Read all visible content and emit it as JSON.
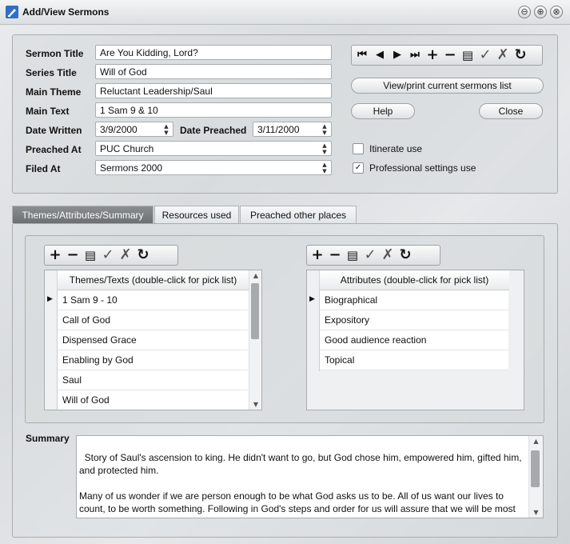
{
  "window": {
    "title": "Add/View Sermons",
    "buttons": [
      "⊖",
      "⊕",
      "⊗"
    ]
  },
  "form": {
    "sermon_title": {
      "label": "Sermon Title",
      "value": "Are You Kidding, Lord?"
    },
    "series_title": {
      "label": "Series Title",
      "value": "Will of God"
    },
    "main_theme": {
      "label": "Main Theme",
      "value": "Reluctant Leadership/Saul"
    },
    "main_text": {
      "label": "Main Text",
      "value": "1 Sam 9 & 10"
    },
    "date_written": {
      "label": "Date Written",
      "value": "3/9/2000"
    },
    "date_preached": {
      "label": "Date Preached",
      "value": "3/11/2000"
    },
    "preached_at": {
      "label": "Preached At",
      "value": "PUC Church"
    },
    "filed_at": {
      "label": "Filed At",
      "value": "Sermons 2000"
    }
  },
  "nav_toolbar": [
    "first-icon",
    "prev-icon",
    "next-icon",
    "last-icon",
    "add-icon",
    "remove-icon",
    "edit-icon",
    "check-icon",
    "cancel-icon",
    "refresh-icon"
  ],
  "buttons": {
    "view_print": "View/print current sermons list",
    "help": "Help",
    "close": "Close"
  },
  "options": {
    "itinerate": {
      "label": "Itinerate use",
      "checked": false
    },
    "professional": {
      "label": "Professional settings use",
      "checked": true
    }
  },
  "tabs": [
    {
      "label": "Themes/Attributes/Summary",
      "active": true
    },
    {
      "label": "Resources used",
      "active": false
    },
    {
      "label": "Preached other places",
      "active": false
    }
  ],
  "themes_grid": {
    "header": "Themes/Texts (double-click for pick list)",
    "rows": [
      "1 Sam 9 - 10",
      "Call of God",
      "Dispensed Grace",
      "Enabling by God",
      "Saul",
      "Will of God"
    ],
    "current_row": 0
  },
  "attributes_grid": {
    "header": "Attributes (double-click for pick list)",
    "rows": [
      "Biographical",
      "Expository",
      "Good audience reaction",
      "Topical"
    ],
    "current_row": 0
  },
  "summary": {
    "label": "Summary",
    "text": "Story of Saul's ascension to king. He didn't want to go, but God chose him, empowered him, gifted him, and protected him.\n\nMany of us wonder if we are person enough to be what God asks us to be. All of us want our lives to count, to be worth something. Following in God's steps and order for us will assure that we will be most free to be a contributing person in life."
  },
  "colors": {
    "accent": "#2f6fc4",
    "active_tab": "#6c7073",
    "background": "#dcdfe1"
  }
}
